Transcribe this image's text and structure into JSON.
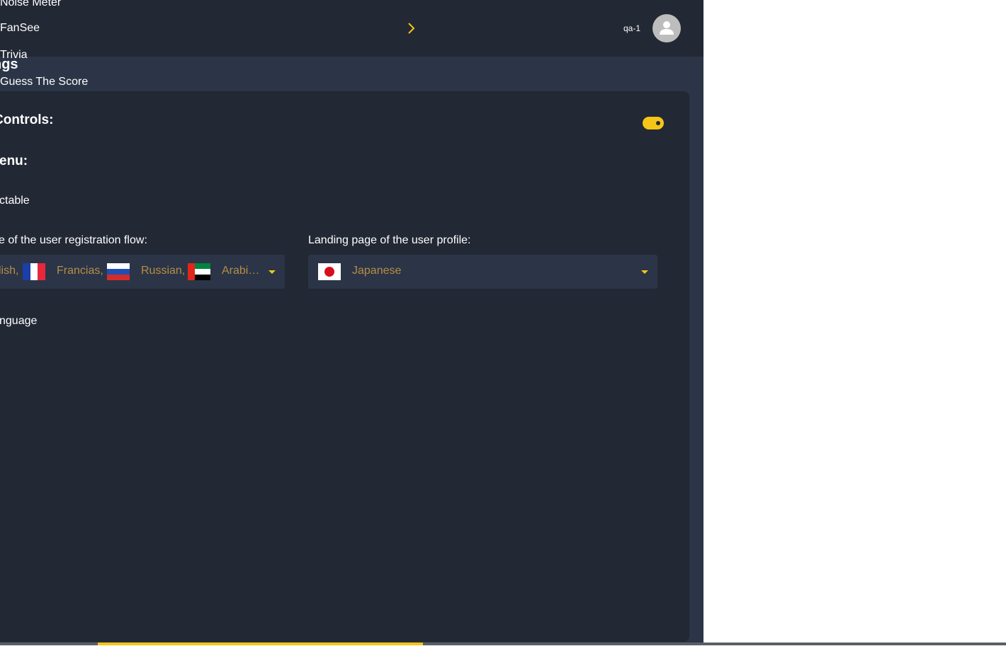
{
  "nav": {
    "items": [
      "Noise Meter",
      "FanSee",
      "Trivia",
      "Guess The Score"
    ]
  },
  "user": {
    "name": "qa-1"
  },
  "page": {
    "heading_fragment": "ngs"
  },
  "settings": {
    "controls_label": "Controls:",
    "controls_toggle_on": true,
    "menu_label": "enu:",
    "selectable_label": "ctable",
    "registration_label": "e of the user registration flow:",
    "registration_languages": [
      "lish,",
      "Francias,",
      "Russian,",
      "Arabi…"
    ],
    "profile_label": "Landing page of the user profile:",
    "profile_language": "Japanese",
    "language_label": "nguage"
  },
  "colors": {
    "accent": "#f5c518",
    "panel": "#222834",
    "background": "#2b3547",
    "select_text": "#b68d45"
  }
}
